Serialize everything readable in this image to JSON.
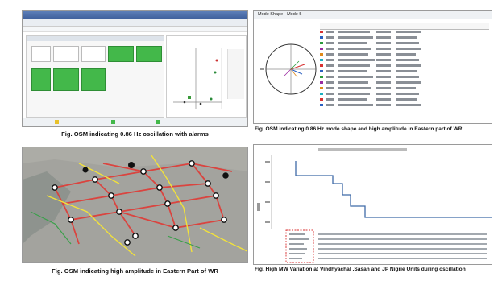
{
  "captions": {
    "p1": "Fig. OSM indicating 0.86 Hz oscillation with alarms",
    "p2": "Fig. OSM indicating 0.86 Hz mode shape and high amplitude in Eastern part of WR",
    "p3": "Fig. OSM indicating high amplitude in Eastern Part of WR",
    "p4": "Fig. High MW Variation at Vindhyachal ,Sasan and JP Nigrie Units during oscillation"
  },
  "panel2": {
    "title": "Mode Shape - Mode 5"
  },
  "colors": {
    "alarm_green": "#43b84a",
    "map_line_red": "#e03a35",
    "map_line_yellow": "#f2e23a",
    "trend_blue": "#3f6aa8",
    "highlight_red": "#d83030"
  }
}
